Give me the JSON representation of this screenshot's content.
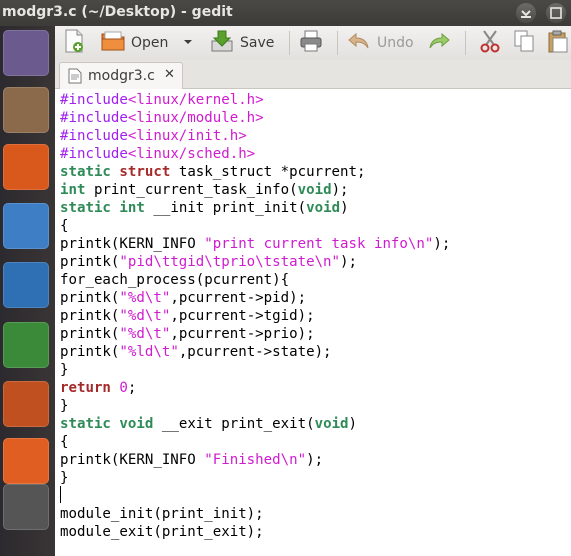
{
  "window": {
    "title": "modgr3.c (~/Desktop) - gedit"
  },
  "toolbar": {
    "open_label": "Open",
    "save_label": "Save",
    "undo_label": "Undo"
  },
  "tab": {
    "label": "modgr3.c",
    "close": "✕"
  },
  "code_lines": [
    [
      {
        "t": "#include",
        "c": "pre"
      },
      {
        "t": "<linux/kernel.h>",
        "c": "str"
      }
    ],
    [
      {
        "t": "#include",
        "c": "pre"
      },
      {
        "t": "<linux/module.h>",
        "c": "str"
      }
    ],
    [
      {
        "t": "#include",
        "c": "pre"
      },
      {
        "t": "<linux/init.h>",
        "c": "str"
      }
    ],
    [
      {
        "t": "#include",
        "c": "pre"
      },
      {
        "t": "<linux/sched.h>",
        "c": "str"
      }
    ],
    [
      {
        "t": "static",
        "c": "ty"
      },
      {
        "t": " "
      },
      {
        "t": "struct",
        "c": "kw2"
      },
      {
        "t": " task_struct *pcurrent;"
      }
    ],
    [
      {
        "t": "int",
        "c": "ty"
      },
      {
        "t": " print_current_task_info("
      },
      {
        "t": "void",
        "c": "ty"
      },
      {
        "t": ");"
      }
    ],
    [
      {
        "t": "static",
        "c": "ty"
      },
      {
        "t": " "
      },
      {
        "t": "int",
        "c": "ty"
      },
      {
        "t": " __init print_init("
      },
      {
        "t": "void",
        "c": "ty"
      },
      {
        "t": ")"
      }
    ],
    [
      {
        "t": "{"
      }
    ],
    [
      {
        "t": "printk(KERN_INFO "
      },
      {
        "t": "\"print current task info\\n\"",
        "c": "str"
      },
      {
        "t": ");"
      }
    ],
    [
      {
        "t": "printk("
      },
      {
        "t": "\"pid\\ttgid\\tprio\\tstate\\n\"",
        "c": "str"
      },
      {
        "t": ");"
      }
    ],
    [
      {
        "t": "for_each_process(pcurrent){"
      }
    ],
    [
      {
        "t": "printk("
      },
      {
        "t": "\"%d\\t\"",
        "c": "str"
      },
      {
        "t": ",pcurrent->pid);"
      }
    ],
    [
      {
        "t": "printk("
      },
      {
        "t": "\"%d\\t\"",
        "c": "str"
      },
      {
        "t": ",pcurrent->tgid);"
      }
    ],
    [
      {
        "t": "printk("
      },
      {
        "t": "\"%d\\t\"",
        "c": "str"
      },
      {
        "t": ",pcurrent->prio);"
      }
    ],
    [
      {
        "t": "printk("
      },
      {
        "t": "\"%ld\\t\"",
        "c": "str"
      },
      {
        "t": ",pcurrent->state);"
      }
    ],
    [
      {
        "t": "}"
      }
    ],
    [
      {
        "t": "return",
        "c": "kw2"
      },
      {
        "t": " "
      },
      {
        "t": "0",
        "c": "num"
      },
      {
        "t": ";"
      }
    ],
    [
      {
        "t": "}"
      }
    ],
    [
      {
        "t": "static",
        "c": "ty"
      },
      {
        "t": " "
      },
      {
        "t": "void",
        "c": "ty"
      },
      {
        "t": " __exit print_exit("
      },
      {
        "t": "void",
        "c": "ty"
      },
      {
        "t": ")"
      }
    ],
    [
      {
        "t": "{"
      }
    ],
    [
      {
        "t": "printk(KERN_INFO "
      },
      {
        "t": "\"Finished\\n\"",
        "c": "str"
      },
      {
        "t": ");"
      }
    ],
    [
      {
        "t": "}"
      }
    ],
    [
      {
        "t": ""
      }
    ],
    [
      {
        "t": "module_init(print_init);"
      }
    ],
    [
      {
        "t": "module_exit(print_exit);"
      }
    ]
  ],
  "launcher": [
    {
      "name": "ubuntu-dash-icon",
      "bg": "#6b5a8e"
    },
    {
      "name": "files-icon",
      "bg": "#8a6a4a"
    },
    {
      "name": "firefox-icon",
      "bg": "#d9581c"
    },
    {
      "name": "chromium-icon",
      "bg": "#3d7ec4"
    },
    {
      "name": "writer-icon",
      "bg": "#2f6fb3"
    },
    {
      "name": "calc-icon",
      "bg": "#3a8a3a"
    },
    {
      "name": "impress-icon",
      "bg": "#c0501f"
    },
    {
      "name": "software-center-icon",
      "bg": "#e05e22"
    },
    {
      "name": "terminal-icon",
      "bg": "#555555"
    }
  ],
  "colors": {
    "titlebar": "#3c3b37",
    "launcher": "#2c2a2f",
    "accent": "#dd4814"
  }
}
